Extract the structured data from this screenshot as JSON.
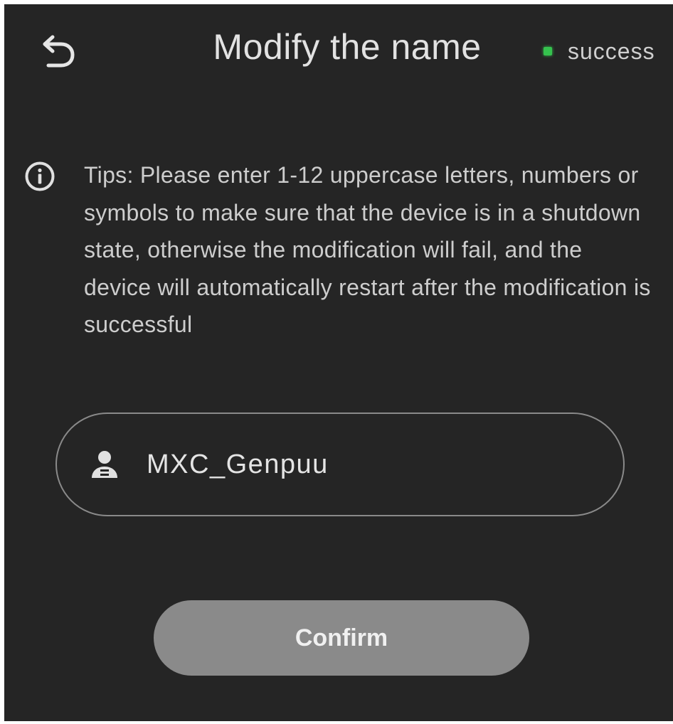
{
  "header": {
    "back_icon": "undo-arrow-icon",
    "title": "Modify the name",
    "status": {
      "label": "success",
      "color": "#35c24e"
    }
  },
  "tips": {
    "icon": "info-icon",
    "text": "Tips: Please enter 1-12 uppercase letters, numbers or symbols to make sure that the device is in a shutdown state, otherwise the modification will fail, and the device will automatically restart after the modification is successful"
  },
  "name_field": {
    "icon": "user-icon",
    "value": "MXC_Genpuu"
  },
  "confirm_button": {
    "label": "Confirm",
    "color": "#8a8a8a"
  },
  "colors": {
    "background": "#252525",
    "text": "#cdcdcd"
  }
}
